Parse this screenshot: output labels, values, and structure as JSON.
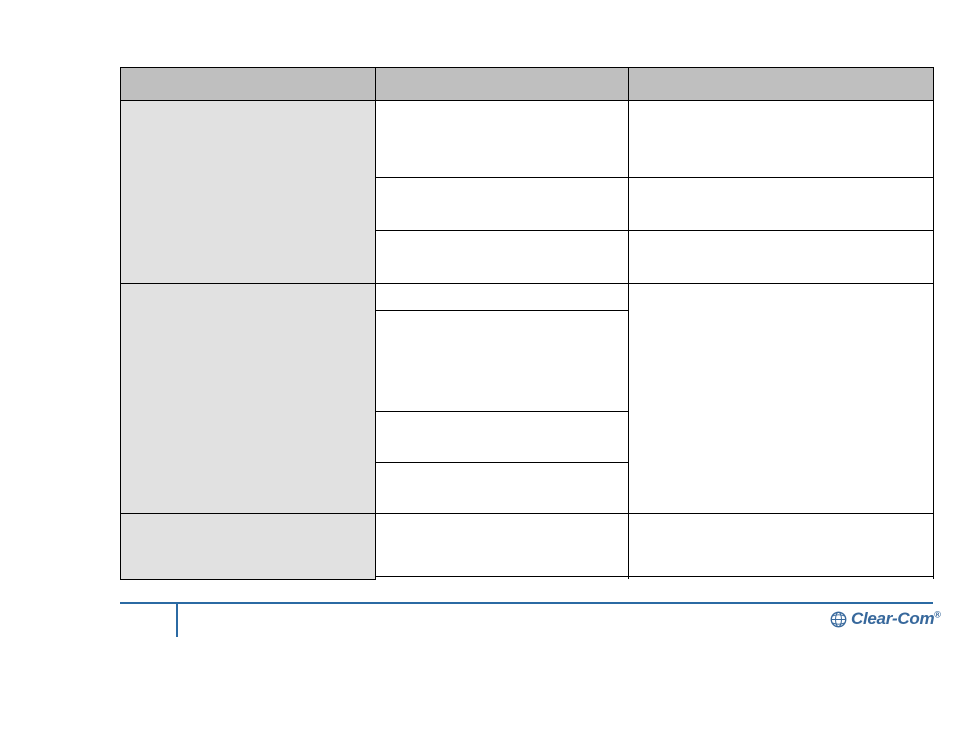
{
  "table": {
    "headers": [
      "",
      "",
      ""
    ],
    "rows": [
      {
        "cat": "",
        "cells": [
          {
            "center": "",
            "right": ""
          },
          {
            "center": "",
            "right": ""
          },
          {
            "center": "",
            "right": ""
          }
        ]
      },
      {
        "cat": "",
        "right_merged": "",
        "cells_center": [
          "",
          "",
          "",
          ""
        ]
      },
      {
        "cat": "",
        "cells": [
          {
            "center": "",
            "right": ""
          }
        ]
      }
    ]
  },
  "footer": {
    "page_number": "",
    "logo_text": "Clear-Com",
    "logo_reg": "®"
  }
}
